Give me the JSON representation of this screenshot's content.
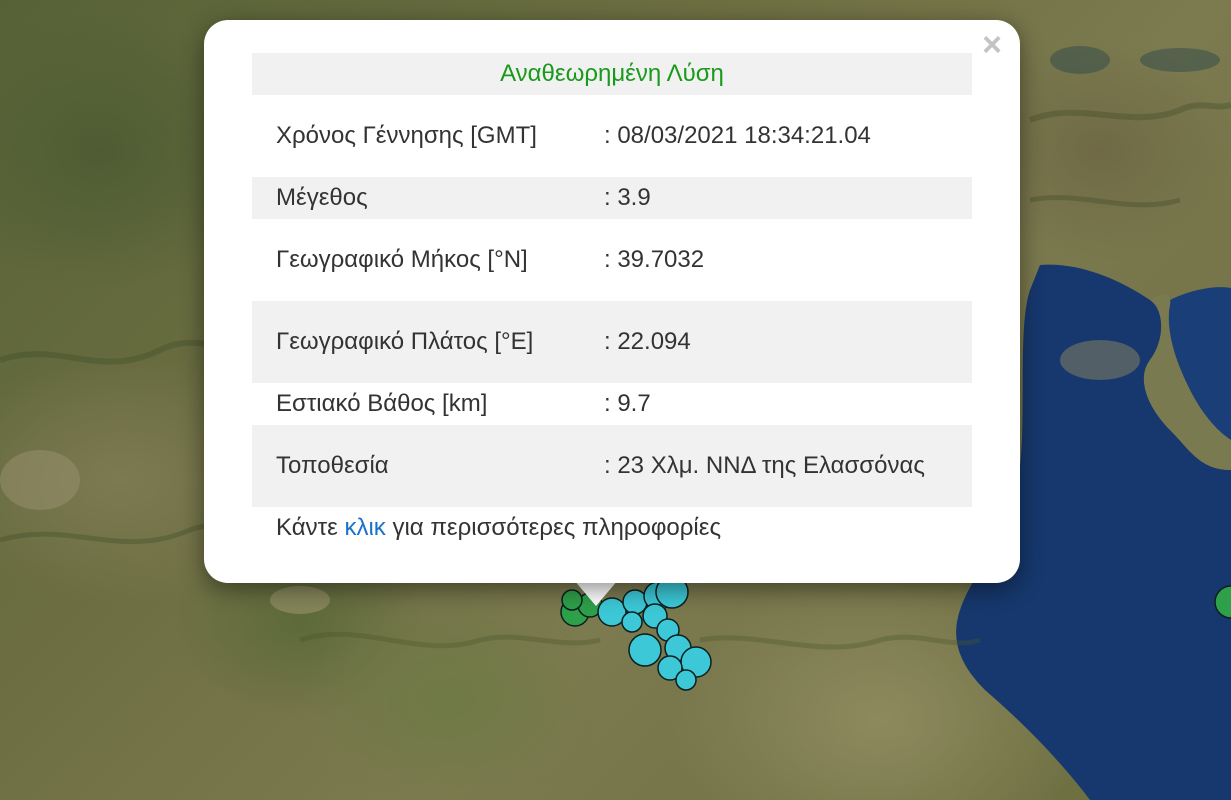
{
  "popup": {
    "close_label": "×",
    "title": "Αναθεωρημένη Λύση",
    "rows": [
      {
        "label": "Χρόνος Γέννησης [GMT]",
        "value": ": 08/03/2021 18:34:21.04"
      },
      {
        "label": "Μέγεθος",
        "value": ": 3.9"
      },
      {
        "label": "Γεωγραφικό Μήκος [°N]",
        "value": ": 39.7032"
      },
      {
        "label": "Γεωγραφικό Πλάτος [°E]",
        "value": ": 22.094"
      },
      {
        "label": "Εστιακό Βάθος [km]",
        "value": ": 9.7"
      },
      {
        "label": "Τοποθεσία",
        "value": ": 23 Χλμ. ΝΝΔ της Ελασσόνας"
      }
    ],
    "footer": {
      "prefix": "Κάντε ",
      "link": "κλικ",
      "suffix": " για περισσότερες πληροφορίες"
    }
  },
  "colors": {
    "title_green": "#1a9a1a",
    "link_blue": "#1a73c9",
    "sea": "#16386e",
    "marker_cyan": "#3cc8d6",
    "marker_green": "#2ea04a"
  }
}
